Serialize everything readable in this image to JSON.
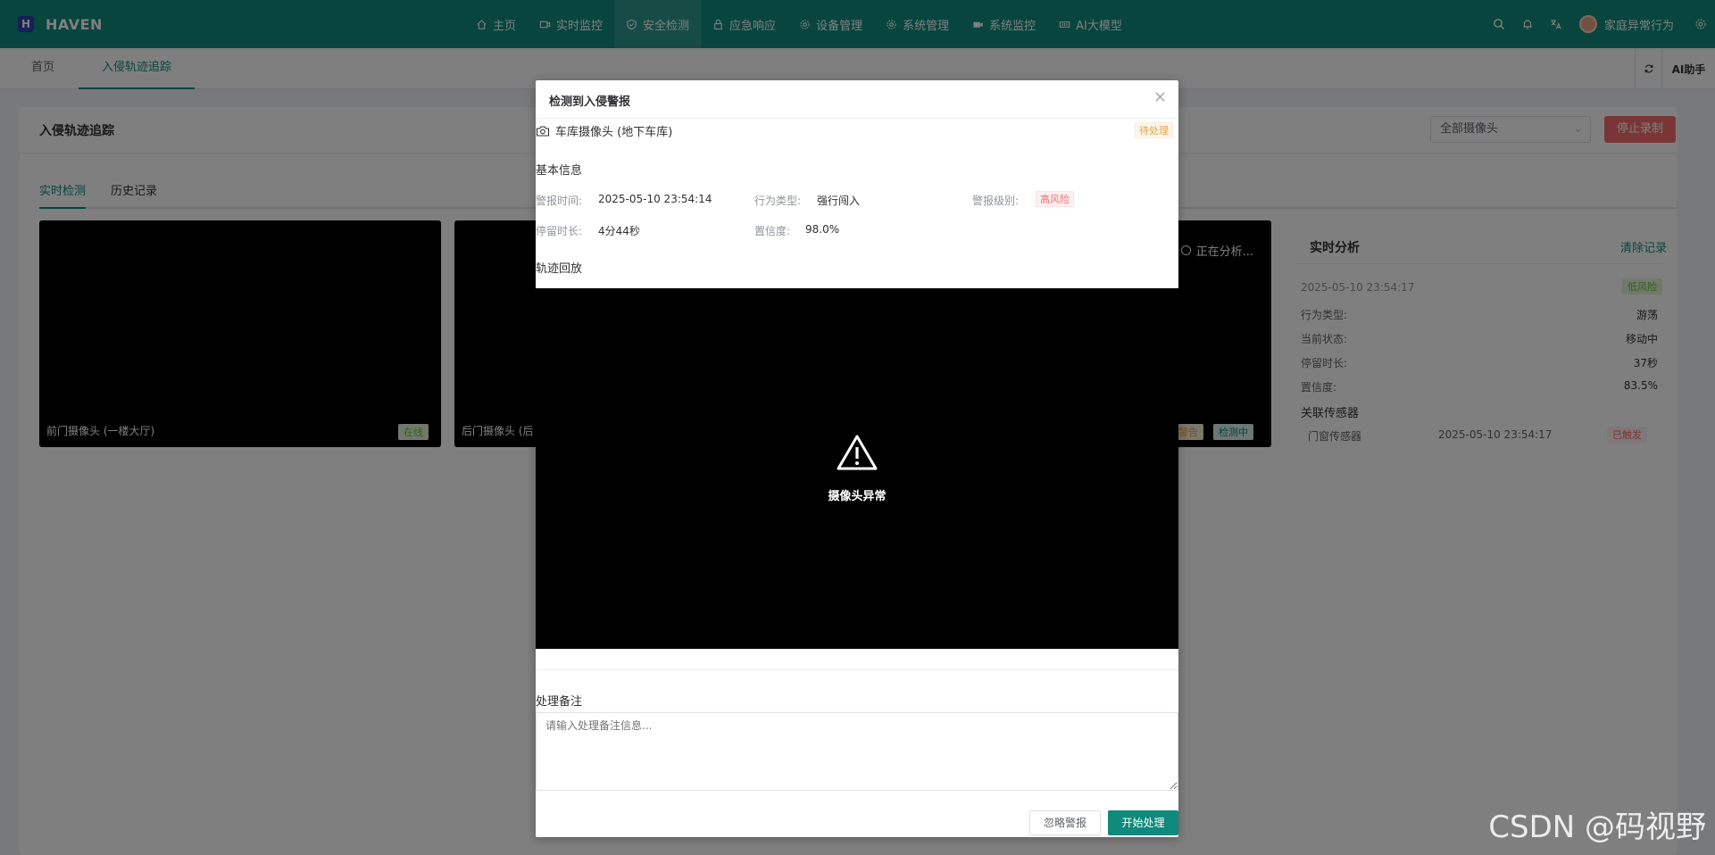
{
  "app": {
    "logo_letter": "H",
    "name": "HAVEN"
  },
  "nav": {
    "items": [
      {
        "label": "主页",
        "icon": "home-icon"
      },
      {
        "label": "实时监控",
        "icon": "video-icon"
      },
      {
        "label": "安全检测",
        "icon": "shield-icon",
        "active": true
      },
      {
        "label": "应急响应",
        "icon": "lock-icon"
      },
      {
        "label": "设备管理",
        "icon": "gear-icon"
      },
      {
        "label": "系统管理",
        "icon": "gear-icon"
      },
      {
        "label": "系统监控",
        "icon": "camera-icon"
      },
      {
        "label": "AI大模型",
        "icon": "ai-icon"
      }
    ],
    "right": {
      "username": "家庭异常行为"
    }
  },
  "tabs": {
    "items": [
      {
        "label": "首页"
      },
      {
        "label": "入侵轨迹追踪",
        "active": true
      }
    ],
    "ai_helper": "AI助手"
  },
  "page": {
    "title": "入侵轨迹追踪",
    "camera_select": "全部摄像头",
    "stop_button": "停止录制",
    "subtabs": [
      "实时检测",
      "历史记录"
    ],
    "tiles": [
      {
        "label": "前门摄像头 (一楼大厅)",
        "badge": "在线"
      },
      {
        "label": "后门摄像头 (后"
      },
      {
        "analyzing": "正在分析...",
        "badge_warn": "警告",
        "badge_detect": "检测中"
      }
    ],
    "analysis": {
      "title": "实时分析",
      "clear": "清除记录",
      "time": "2025-05-10 23:54:17",
      "risk": "低风险",
      "rows": [
        {
          "label": "行为类型:",
          "value": "游荡"
        },
        {
          "label": "当前状态:",
          "value": "移动中"
        },
        {
          "label": "停留时长:",
          "value": "37秒"
        },
        {
          "label": "置信度:",
          "value": "83.5%"
        }
      ],
      "sensor_title": "关联传感器",
      "sensor": {
        "name": "门窗传感器",
        "time": "2025-05-10 23:54:17",
        "status": "已触发"
      }
    }
  },
  "dialog": {
    "title": "检测到入侵警报",
    "camera": "车库摄像头 (地下车库)",
    "status": "待处理",
    "basic_title": "基本信息",
    "alert_time_label": "警报时间:",
    "alert_time": "2025-05-10 23:54:14",
    "behavior_label": "行为类型:",
    "behavior": "强行闯入",
    "level_label": "警报级别:",
    "level": "高风险",
    "duration_label": "停留时长:",
    "duration": "4分44秒",
    "confidence_label": "置信度:",
    "confidence": "98.0%",
    "track_title": "轨迹回放",
    "camera_error": "摄像头异常",
    "note_title": "处理备注",
    "note_placeholder": "请输入处理备注信息...",
    "ignore_button": "忽略警报",
    "start_button": "开始处理"
  },
  "watermark": "CSDN @码视野"
}
